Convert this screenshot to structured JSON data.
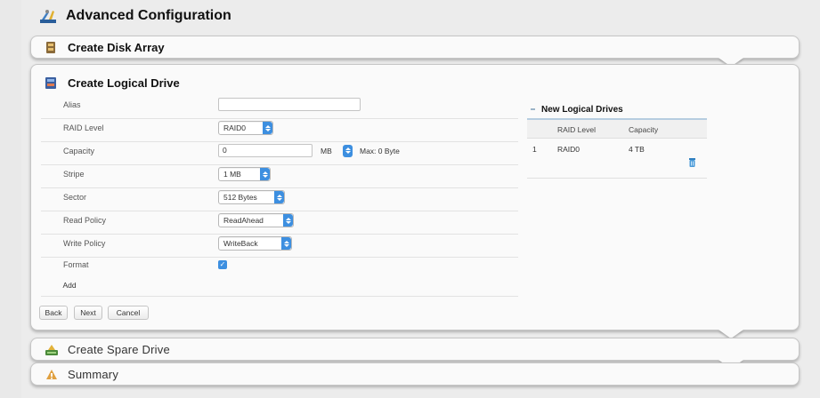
{
  "header": {
    "title": "Advanced Configuration",
    "icon": "wrench-screwdriver-icon"
  },
  "panels": {
    "disk_array": {
      "title": "Create Disk Array",
      "icon": "disk-array-icon"
    },
    "logical_drive": {
      "title": "Create Logical Drive",
      "icon": "logical-drive-icon"
    },
    "spare_drive": {
      "title": "Create Spare Drive",
      "icon": "spare-drive-icon"
    },
    "summary": {
      "title": "Summary",
      "icon": "summary-icon"
    }
  },
  "form": {
    "alias": {
      "label": "Alias",
      "value": ""
    },
    "raid_level": {
      "label": "RAID Level",
      "value": "RAID0"
    },
    "capacity": {
      "label": "Capacity",
      "value": "0",
      "unit": "MB",
      "max": "Max: 0 Byte"
    },
    "stripe": {
      "label": "Stripe",
      "value": "1 MB"
    },
    "sector": {
      "label": "Sector",
      "value": "512 Bytes"
    },
    "read_policy": {
      "label": "Read Policy",
      "value": "ReadAhead"
    },
    "write_policy": {
      "label": "Write Policy",
      "value": "WriteBack"
    },
    "format": {
      "label": "Format",
      "checked": true,
      "checkmark": "✓"
    },
    "add_label": "Add"
  },
  "nav": {
    "back": "Back",
    "next": "Next",
    "cancel": "Cancel"
  },
  "new_logical_drives": {
    "title": "New Logical Drives",
    "columns": [
      "RAID Level",
      "Capacity"
    ],
    "rows": [
      {
        "index": "1",
        "raid_level": "RAID0",
        "capacity": "4 TB"
      }
    ]
  },
  "colors": {
    "accent": "#3d8fe0",
    "panel_bg": "#fafafa",
    "page_bg": "#ececec"
  }
}
